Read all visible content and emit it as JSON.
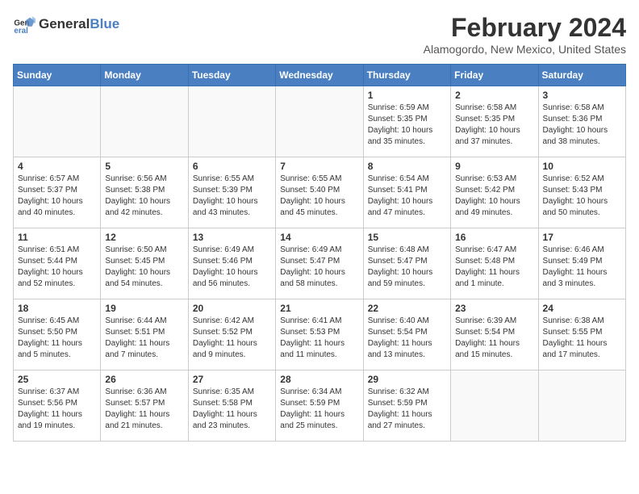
{
  "logo": {
    "general": "General",
    "blue": "Blue"
  },
  "title": {
    "month_year": "February 2024",
    "location": "Alamogordo, New Mexico, United States"
  },
  "headers": [
    "Sunday",
    "Monday",
    "Tuesday",
    "Wednesday",
    "Thursday",
    "Friday",
    "Saturday"
  ],
  "weeks": [
    [
      {
        "day": "",
        "info": ""
      },
      {
        "day": "",
        "info": ""
      },
      {
        "day": "",
        "info": ""
      },
      {
        "day": "",
        "info": ""
      },
      {
        "day": "1",
        "info": "Sunrise: 6:59 AM\nSunset: 5:35 PM\nDaylight: 10 hours\nand 35 minutes."
      },
      {
        "day": "2",
        "info": "Sunrise: 6:58 AM\nSunset: 5:35 PM\nDaylight: 10 hours\nand 37 minutes."
      },
      {
        "day": "3",
        "info": "Sunrise: 6:58 AM\nSunset: 5:36 PM\nDaylight: 10 hours\nand 38 minutes."
      }
    ],
    [
      {
        "day": "4",
        "info": "Sunrise: 6:57 AM\nSunset: 5:37 PM\nDaylight: 10 hours\nand 40 minutes."
      },
      {
        "day": "5",
        "info": "Sunrise: 6:56 AM\nSunset: 5:38 PM\nDaylight: 10 hours\nand 42 minutes."
      },
      {
        "day": "6",
        "info": "Sunrise: 6:55 AM\nSunset: 5:39 PM\nDaylight: 10 hours\nand 43 minutes."
      },
      {
        "day": "7",
        "info": "Sunrise: 6:55 AM\nSunset: 5:40 PM\nDaylight: 10 hours\nand 45 minutes."
      },
      {
        "day": "8",
        "info": "Sunrise: 6:54 AM\nSunset: 5:41 PM\nDaylight: 10 hours\nand 47 minutes."
      },
      {
        "day": "9",
        "info": "Sunrise: 6:53 AM\nSunset: 5:42 PM\nDaylight: 10 hours\nand 49 minutes."
      },
      {
        "day": "10",
        "info": "Sunrise: 6:52 AM\nSunset: 5:43 PM\nDaylight: 10 hours\nand 50 minutes."
      }
    ],
    [
      {
        "day": "11",
        "info": "Sunrise: 6:51 AM\nSunset: 5:44 PM\nDaylight: 10 hours\nand 52 minutes."
      },
      {
        "day": "12",
        "info": "Sunrise: 6:50 AM\nSunset: 5:45 PM\nDaylight: 10 hours\nand 54 minutes."
      },
      {
        "day": "13",
        "info": "Sunrise: 6:49 AM\nSunset: 5:46 PM\nDaylight: 10 hours\nand 56 minutes."
      },
      {
        "day": "14",
        "info": "Sunrise: 6:49 AM\nSunset: 5:47 PM\nDaylight: 10 hours\nand 58 minutes."
      },
      {
        "day": "15",
        "info": "Sunrise: 6:48 AM\nSunset: 5:47 PM\nDaylight: 10 hours\nand 59 minutes."
      },
      {
        "day": "16",
        "info": "Sunrise: 6:47 AM\nSunset: 5:48 PM\nDaylight: 11 hours\nand 1 minute."
      },
      {
        "day": "17",
        "info": "Sunrise: 6:46 AM\nSunset: 5:49 PM\nDaylight: 11 hours\nand 3 minutes."
      }
    ],
    [
      {
        "day": "18",
        "info": "Sunrise: 6:45 AM\nSunset: 5:50 PM\nDaylight: 11 hours\nand 5 minutes."
      },
      {
        "day": "19",
        "info": "Sunrise: 6:44 AM\nSunset: 5:51 PM\nDaylight: 11 hours\nand 7 minutes."
      },
      {
        "day": "20",
        "info": "Sunrise: 6:42 AM\nSunset: 5:52 PM\nDaylight: 11 hours\nand 9 minutes."
      },
      {
        "day": "21",
        "info": "Sunrise: 6:41 AM\nSunset: 5:53 PM\nDaylight: 11 hours\nand 11 minutes."
      },
      {
        "day": "22",
        "info": "Sunrise: 6:40 AM\nSunset: 5:54 PM\nDaylight: 11 hours\nand 13 minutes."
      },
      {
        "day": "23",
        "info": "Sunrise: 6:39 AM\nSunset: 5:54 PM\nDaylight: 11 hours\nand 15 minutes."
      },
      {
        "day": "24",
        "info": "Sunrise: 6:38 AM\nSunset: 5:55 PM\nDaylight: 11 hours\nand 17 minutes."
      }
    ],
    [
      {
        "day": "25",
        "info": "Sunrise: 6:37 AM\nSunset: 5:56 PM\nDaylight: 11 hours\nand 19 minutes."
      },
      {
        "day": "26",
        "info": "Sunrise: 6:36 AM\nSunset: 5:57 PM\nDaylight: 11 hours\nand 21 minutes."
      },
      {
        "day": "27",
        "info": "Sunrise: 6:35 AM\nSunset: 5:58 PM\nDaylight: 11 hours\nand 23 minutes."
      },
      {
        "day": "28",
        "info": "Sunrise: 6:34 AM\nSunset: 5:59 PM\nDaylight: 11 hours\nand 25 minutes."
      },
      {
        "day": "29",
        "info": "Sunrise: 6:32 AM\nSunset: 5:59 PM\nDaylight: 11 hours\nand 27 minutes."
      },
      {
        "day": "",
        "info": ""
      },
      {
        "day": "",
        "info": ""
      }
    ]
  ]
}
